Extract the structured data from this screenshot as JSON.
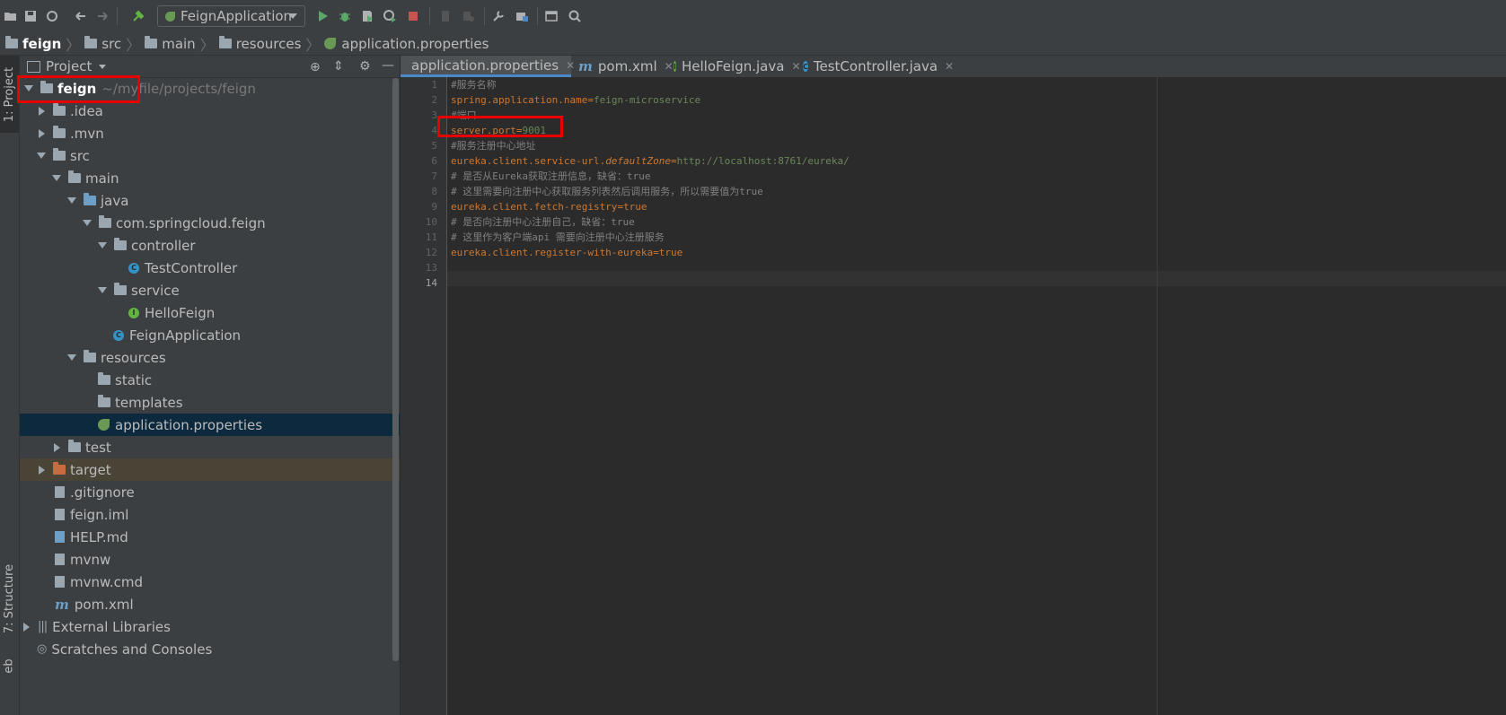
{
  "toolbar": {
    "run_config": "FeignApplication",
    "icons": [
      "open-icon",
      "save-icon",
      "sync-icon",
      "back-icon",
      "forward-icon",
      "build-icon",
      "run-icon",
      "debug-icon",
      "coverage-icon",
      "profile-icon",
      "stop-icon",
      "attach-icon",
      "attach-debugger-icon",
      "settings-icon",
      "project-structure-icon",
      "terminal-icon",
      "search-icon"
    ]
  },
  "breadcrumb": {
    "items": [
      "feign",
      "src",
      "main",
      "resources",
      "application.properties"
    ]
  },
  "stripe": {
    "project_tab": "1: Project",
    "structure_tab": "7: Structure",
    "web_tab": "eb"
  },
  "panel": {
    "title": "Project",
    "tree": [
      {
        "label": "feign",
        "extra": "~/myfile/projects/feign"
      },
      {
        "label": ".idea"
      },
      {
        "label": ".mvn"
      },
      {
        "label": "src"
      },
      {
        "label": "main"
      },
      {
        "label": "java"
      },
      {
        "label": "com.springcloud.feign"
      },
      {
        "label": "controller"
      },
      {
        "label": "TestController"
      },
      {
        "label": "service"
      },
      {
        "label": "HelloFeign"
      },
      {
        "label": "FeignApplication"
      },
      {
        "label": "resources"
      },
      {
        "label": "static"
      },
      {
        "label": "templates"
      },
      {
        "label": "application.properties"
      },
      {
        "label": "test"
      },
      {
        "label": "target"
      },
      {
        "label": ".gitignore"
      },
      {
        "label": "feign.iml"
      },
      {
        "label": "HELP.md"
      },
      {
        "label": "mvnw"
      },
      {
        "label": "mvnw.cmd"
      },
      {
        "label": "pom.xml"
      },
      {
        "label": "External Libraries"
      },
      {
        "label": "Scratches and Consoles"
      }
    ]
  },
  "editor": {
    "tabs": [
      "application.properties",
      "pom.xml",
      "HelloFeign.java",
      "TestController.java"
    ],
    "line_numbers": [
      "1",
      "2",
      "3",
      "4",
      "5",
      "6",
      "7",
      "8",
      "9",
      "10",
      "11",
      "12",
      "13",
      "14"
    ],
    "lines": {
      "l1": "#服务名称",
      "l2_key": "spring.application.name",
      "l2_eq": "=",
      "l2_val": "feign-microservice",
      "l3": "#端口",
      "l4_key": "server.port",
      "l4_eq": "=",
      "l4_val": "9001",
      "l5": "#服务注册中心地址",
      "l6_key1": "eureka.client.service-url.",
      "l6_key2": "defaultZone",
      "l6_eq": "=",
      "l6_val": "http://localhost:8761/eureka/",
      "l7": "# 是否从Eureka获取注册信息，缺省：true",
      "l8": "# 这里需要向注册中心获取服务列表然后调用服务，所以需要值为true",
      "l9_key": "eureka.client.fetch-registry",
      "l9_eq": "=",
      "l9_val": "true",
      "l10": "# 是否向注册中心注册自己，缺省：true",
      "l11": "# 这里作为客户端api 需要向注册中心注册服务",
      "l12_key": "eureka.client.register-with-eureka",
      "l12_eq": "=",
      "l12_val": "true"
    }
  },
  "colors": {
    "highlight_box": "#e80000",
    "keyword": "#cc7832",
    "value": "#6a8759",
    "comment": "#808080",
    "selection": "#0d293e"
  }
}
